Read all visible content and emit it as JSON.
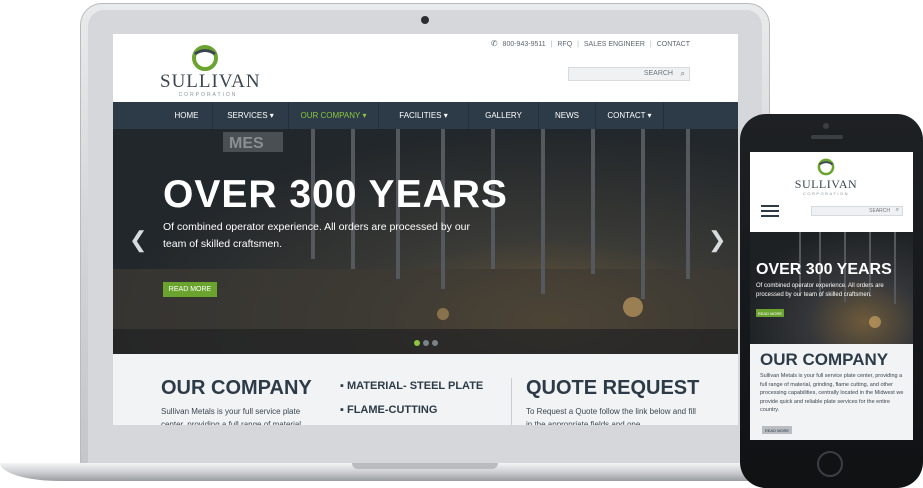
{
  "colors": {
    "nav_bg": "#2c3b47",
    "accent_green": "#8cc63f",
    "button_green": "#6ba32f",
    "text_dark": "#2c3b47"
  },
  "site": {
    "logo_name": "SULLIVAN",
    "logo_sub": "CORPORATION",
    "logo_icon": "sullivan-logo-icon"
  },
  "laptop": {
    "util": {
      "phone_icon": "phone-icon",
      "phone": "800-943-9511",
      "rfq": "RFQ",
      "sales": "SALES ENGINEER",
      "contact": "CONTACT"
    },
    "search": {
      "placeholder": "SEARCH",
      "icon": "search-icon"
    },
    "nav": [
      "HOME",
      "SERVICES ▾",
      "OUR COMPANY ▾",
      "FACILITIES ▾",
      "GALLERY",
      "NEWS",
      "CONTACT ▾"
    ],
    "nav_active_index": 2,
    "hero": {
      "title": "OVER 300 YEARS",
      "text": "Of combined operator experience. All orders are processed by our team of skilled craftsmen.",
      "button": "READ MORE",
      "prev_icon": "chevron-left-icon",
      "next_icon": "chevron-right-icon",
      "slides": 3,
      "active_slide": 0
    },
    "lower": {
      "company_title": "OUR COMPANY",
      "company_text": "Sullivan Metals is your full service plate center, providing a full range of material",
      "bullet1": "MATERIAL- STEEL PLATE",
      "bullet2": "FLAME-CUTTING",
      "quote_title": "QUOTE REQUEST",
      "quote_text": "To Request a Quote follow the link below and fill in the appropriate fields and one"
    }
  },
  "phone": {
    "search_placeholder": "SEARCH",
    "menu_icon": "hamburger-menu-icon",
    "hero_title": "OVER 300 YEARS",
    "hero_text": "Of combined operator experience. All orders are processed by our team of skilled craftsmen.",
    "hero_button": "READ MORE",
    "company_title": "OUR COMPANY",
    "company_text": "Sullivan Metals is your full service plate center, providing a full range of material, grinding, flame cutting, and other processing capabilities, centrally located in the Midwest we provide quick and reliable plate services for the entire country.",
    "company_button": "READ MORE"
  }
}
